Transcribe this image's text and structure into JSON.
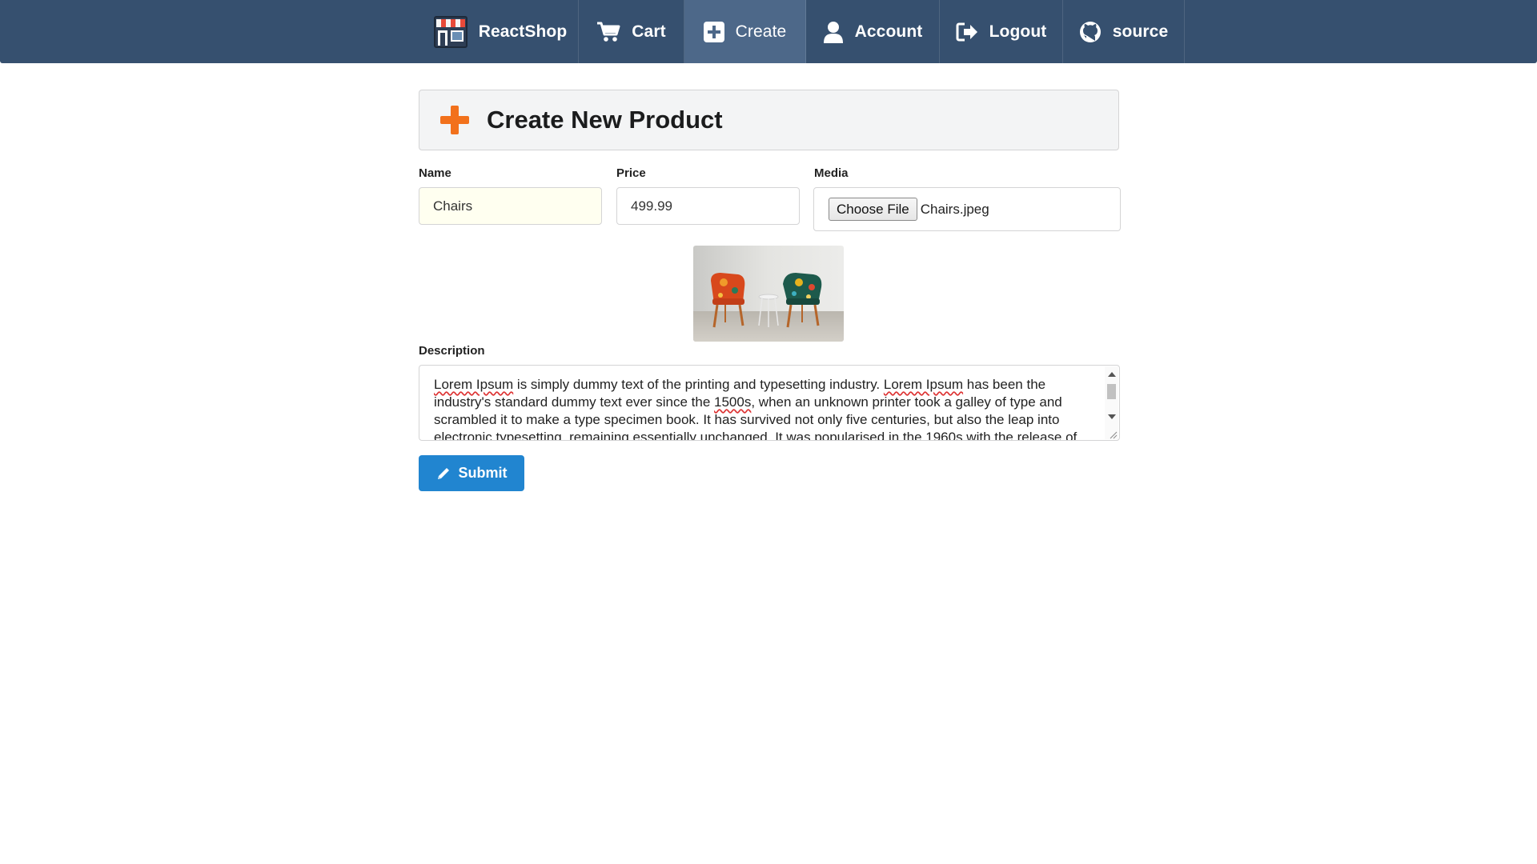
{
  "navbar": {
    "brand": "ReactShop",
    "items": [
      {
        "label": "Cart",
        "icon": "cart-icon"
      },
      {
        "label": "Create",
        "icon": "plus-square-icon",
        "active": true
      },
      {
        "label": "Account",
        "icon": "user-icon"
      },
      {
        "label": "Logout",
        "icon": "sign-out-icon"
      },
      {
        "label": "source",
        "icon": "github-icon"
      }
    ]
  },
  "header": {
    "title": "Create New Product",
    "icon": "add-icon"
  },
  "form": {
    "name": {
      "label": "Name",
      "value": "Chairs"
    },
    "price": {
      "label": "Price",
      "value": "499.99"
    },
    "media": {
      "label": "Media",
      "button": "Choose File",
      "file_name": "Chairs.jpeg"
    },
    "description": {
      "label": "Description",
      "value_parts": [
        "Lorem Ipsum",
        " is simply dummy text of the printing and typesetting industry. ",
        "Lorem Ipsum",
        " has been the industry's standard dummy text ever since the ",
        "1500s",
        ", when an unknown printer took a galley of type and scrambled it to make a type specimen book. It has survived not only five centuries, but also the leap into electronic typesetting, remaining essentially unchanged. It was popularised in the 1960s with the release of"
      ]
    },
    "submit": "Submit"
  },
  "colors": {
    "navbar": "#36506f",
    "navbar_active": "#4d6889",
    "accent_orange": "#f2711c",
    "submit_blue": "#2185d0"
  }
}
